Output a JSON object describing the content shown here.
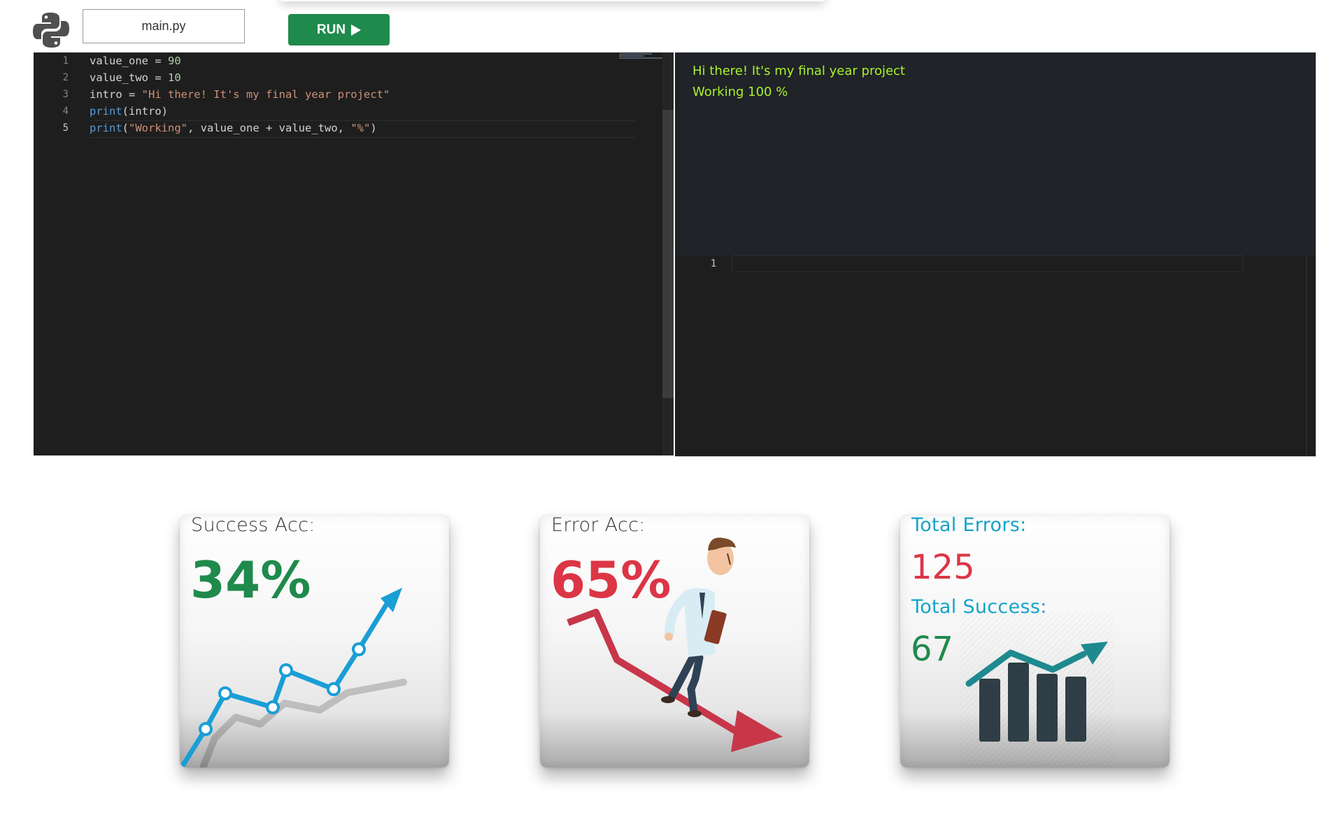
{
  "toolbar": {
    "logo_icon": "python-logo-icon",
    "file_name": "main.py",
    "run_label": "RUN",
    "run_icon": "play-icon",
    "run_color": "#1e8a4c"
  },
  "editor": {
    "lines": [
      {
        "number": "1",
        "parts": [
          {
            "t": "value_one = ",
            "c": "plain"
          },
          {
            "t": "90",
            "c": "num"
          }
        ]
      },
      {
        "number": "2",
        "parts": [
          {
            "t": "value_two = ",
            "c": "plain"
          },
          {
            "t": "10",
            "c": "num"
          }
        ]
      },
      {
        "number": "3",
        "parts": [
          {
            "t": "intro = ",
            "c": "plain"
          },
          {
            "t": "\"Hi there! It's my final year project\"",
            "c": "str"
          }
        ]
      },
      {
        "number": "4",
        "parts": [
          {
            "t": "print",
            "c": "fn"
          },
          {
            "t": "(intro)",
            "c": "plain"
          }
        ]
      },
      {
        "number": "5",
        "parts": [
          {
            "t": "print",
            "c": "fn"
          },
          {
            "t": "(",
            "c": "plain"
          },
          {
            "t": "\"Working\"",
            "c": "str"
          },
          {
            "t": ", value_one + value_two, ",
            "c": "plain"
          },
          {
            "t": "\"%\"",
            "c": "str"
          },
          {
            "t": ")",
            "c": "plain"
          }
        ]
      }
    ],
    "active_line": 5
  },
  "output": {
    "lines": [
      "Hi there! It's my final year project",
      "Working 100 %"
    ],
    "color": "#a8f230"
  },
  "input_editor": {
    "line_number": "1"
  },
  "stats": {
    "success": {
      "label": "Success Acc:",
      "value": "34%",
      "color": "#1e8a4c",
      "icon": "rising-line-chart-icon"
    },
    "error": {
      "label": "Error Acc:",
      "value": "65%",
      "color": "#dc3545",
      "icon": "falling-arrow-businessman-icon"
    },
    "totals": {
      "errors_label": "Total Errors:",
      "errors_value": "125",
      "success_label": "Total Success:",
      "success_value": "67",
      "label_color": "#17a2c8",
      "errors_color": "#dc3545",
      "success_color": "#1e8a4c",
      "icon": "bar-chart-up-arrow-icon"
    }
  }
}
